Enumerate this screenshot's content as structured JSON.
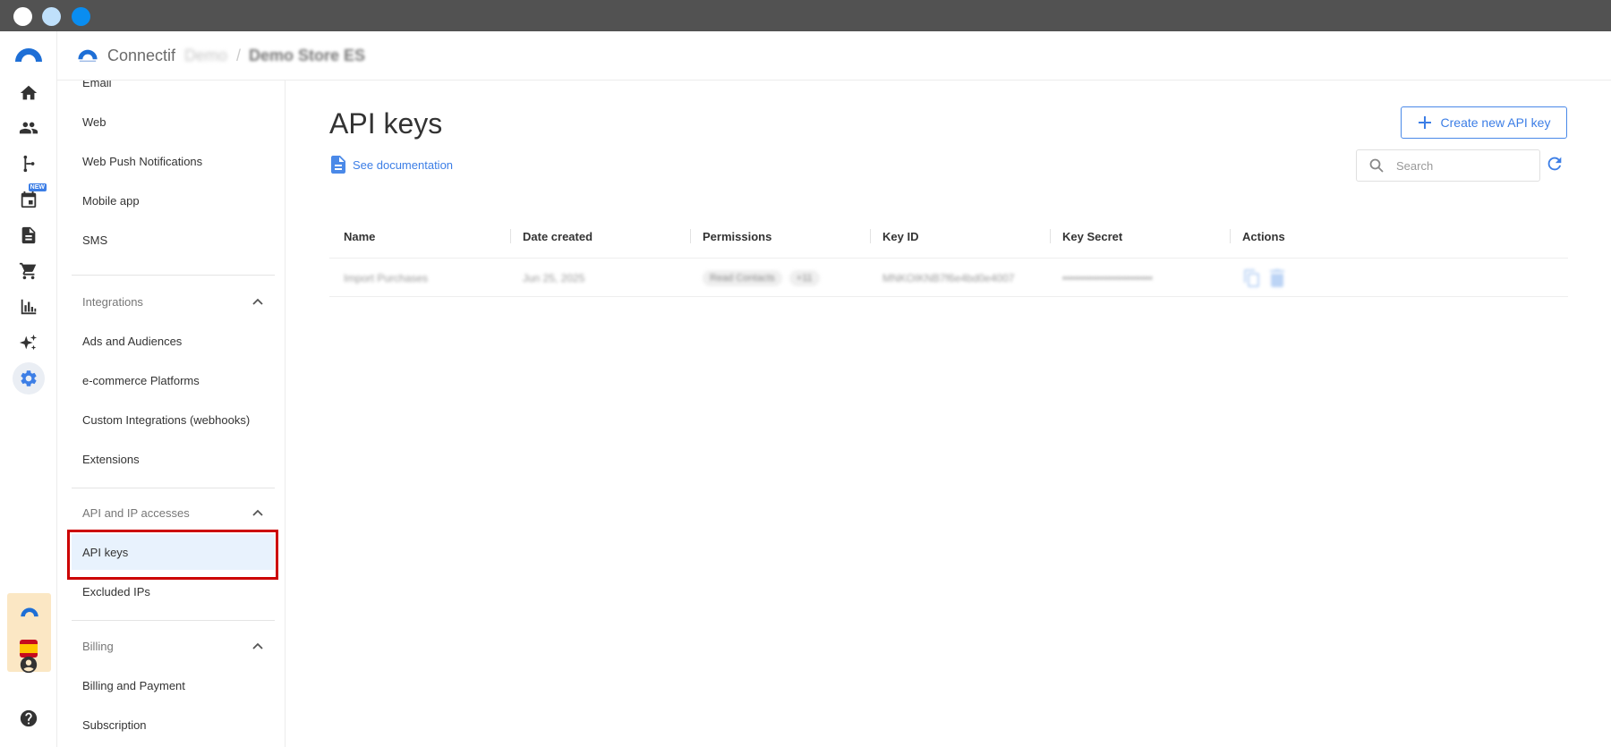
{
  "header": {
    "brand": "Connectif",
    "account_blur": "Demo",
    "separator": "/",
    "store": "Demo Store ES"
  },
  "rail": {
    "new_badge": "NEW",
    "icons": [
      "connectif-logo-icon",
      "home-icon",
      "contacts-icon",
      "workflow-icon",
      "calendar-icon",
      "document-icon",
      "cart-icon",
      "analytics-icon",
      "sparkle-icon",
      "settings-icon",
      "account-icon",
      "help-icon"
    ]
  },
  "sidebar": {
    "top_items": [
      "Email",
      "Web",
      "Web Push Notifications",
      "Mobile app",
      "SMS"
    ],
    "integrations": {
      "title": "Integrations",
      "items": [
        "Ads and Audiences",
        "e-commerce Platforms",
        "Custom Integrations (webhooks)",
        "Extensions"
      ]
    },
    "api": {
      "title": "API and IP accesses",
      "items": [
        "API keys",
        "Excluded IPs"
      ]
    },
    "billing": {
      "title": "Billing",
      "items": [
        "Billing and Payment",
        "Subscription"
      ]
    }
  },
  "main": {
    "title": "API keys",
    "doc_link": "See documentation",
    "create_button": "Create new API key",
    "search_placeholder": "Search",
    "columns": [
      "Name",
      "Date created",
      "Permissions",
      "Key ID",
      "Key Secret",
      "Actions"
    ],
    "rows": [
      {
        "name": "Import Purchases",
        "date": "Jun 25, 2025",
        "permissions": [
          "Read Contacts",
          "+11"
        ],
        "key_id": "MNKOIKNB7f6e4bd0e4007",
        "key_secret": "••••••••••••••••••••••••"
      }
    ]
  },
  "colors": {
    "accent": "#3c7ee6",
    "selected_bg": "#e8f2fd",
    "highlight": "#cc0000",
    "titlebar": "#525252"
  }
}
